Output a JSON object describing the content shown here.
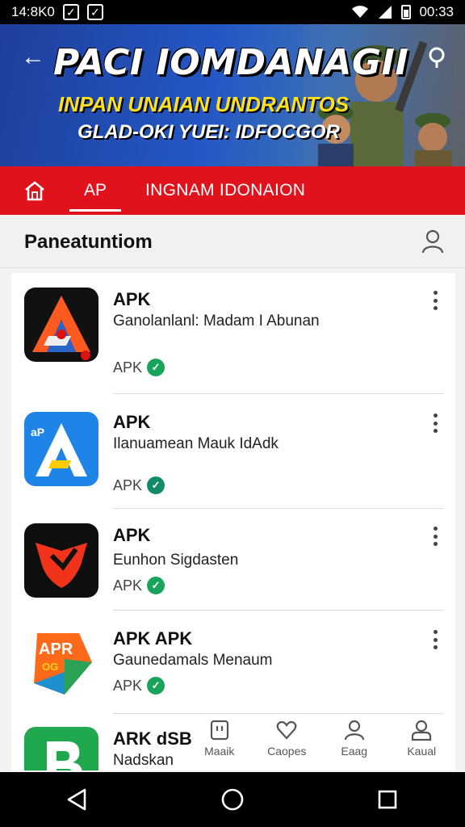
{
  "status_bar": {
    "time_left": "14:8K0",
    "time_right": "00:33"
  },
  "banner": {
    "title": "PACI IOMDANAGII",
    "subtitle1": "INPAN UNAIAN UNDRANTOS",
    "subtitle2": "GLAD-OKI YUEI: IDFOCGOR"
  },
  "tabs": [
    {
      "label": "AP",
      "active": true
    },
    {
      "label": "INGNAM IDONAION",
      "active": false
    }
  ],
  "section": {
    "title": "Paneatuntiom"
  },
  "apps": [
    {
      "title": "APK",
      "description": "Ganolanlanl: Madam I Abunan",
      "tag": "APK",
      "icon": "triangle-a-icon"
    },
    {
      "title": "APK",
      "description": "Ilanuamean Mauk IdAdk",
      "tag": "APK",
      "icon": "blue-a-icon"
    },
    {
      "title": "APK",
      "description": "Eunhon Sigdasten",
      "tag": "APK",
      "icon": "red-shield-icon"
    },
    {
      "title": "APK APK",
      "description": "Gaunedamals Menaum",
      "tag": "APK",
      "icon": "colorful-apr-icon"
    },
    {
      "title": "ARK dSB",
      "description": "Nadskan",
      "tag": "",
      "icon": "green-b-icon"
    }
  ],
  "bottom_nav": [
    {
      "label": "Maaik",
      "icon": "box-icon"
    },
    {
      "label": "Caopes",
      "icon": "heart-icon"
    },
    {
      "label": "Eaag",
      "icon": "person-icon"
    },
    {
      "label": "Kaual",
      "icon": "user-icon"
    }
  ],
  "colors": {
    "tab_red": "#e0121c",
    "banner_blue": "#2457c4",
    "verified_green": "#1aa35a"
  }
}
